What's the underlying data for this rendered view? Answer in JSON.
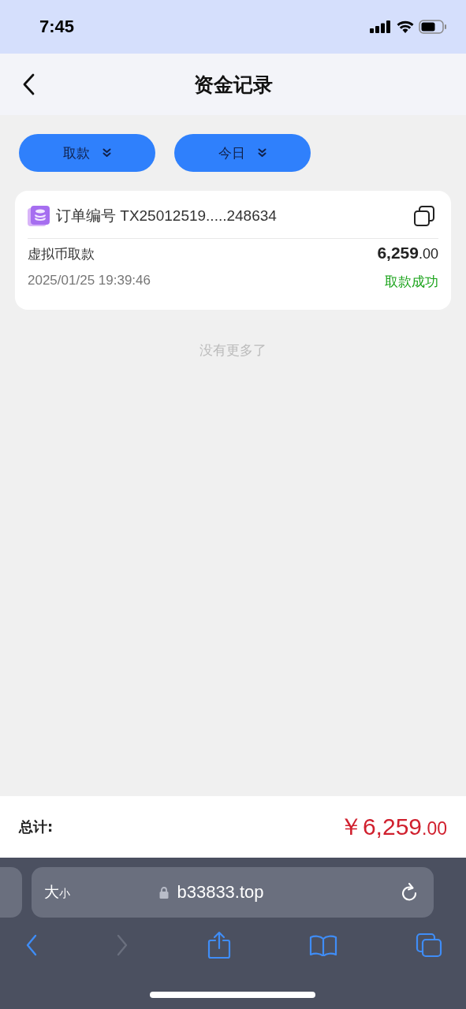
{
  "status_bar": {
    "time": "7:45"
  },
  "header": {
    "title": "资金记录"
  },
  "filters": [
    {
      "label": "取款"
    },
    {
      "label": "今日"
    }
  ],
  "records": [
    {
      "order_label": "订单编号",
      "order_no": "TX25012519.....248634",
      "type": "虚拟币取款",
      "amount_main": "6,259",
      "amount_cents": ".00",
      "time": "2025/01/25 19:39:46",
      "status": "取款成功",
      "color": "#1aa31a"
    }
  ],
  "end_note": "没有更多了",
  "total": {
    "label": "总计:",
    "currency": "￥",
    "amount_main": "6,259",
    "amount_cents": ".00"
  },
  "browser": {
    "text_size_large": "大",
    "text_size_small": "小",
    "url": "b33833.top",
    "toolbar": [
      {
        "kind": "back",
        "disabled": false
      },
      {
        "kind": "forward",
        "disabled": true
      },
      {
        "kind": "share",
        "disabled": false
      },
      {
        "kind": "bookmarks",
        "disabled": false
      },
      {
        "kind": "tabs",
        "disabled": false
      }
    ]
  }
}
